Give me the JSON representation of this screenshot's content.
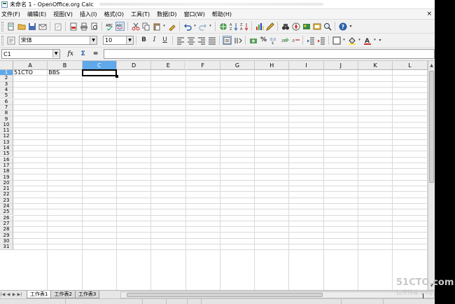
{
  "window": {
    "title": "未命名 1 - OpenOffice.org Calc"
  },
  "menubar": {
    "items": [
      "文件(F)",
      "编辑(E)",
      "视图(V)",
      "插入(I)",
      "格式(O)",
      "工具(T)",
      "数据(D)",
      "窗口(W)",
      "帮助(H)"
    ],
    "close": "×"
  },
  "formatting": {
    "style_value": "",
    "font_name": "宋体",
    "font_size": "10",
    "bold": "B",
    "italic": "I",
    "underline": "U"
  },
  "formula_bar": {
    "name_box": "C1",
    "function_wizard": "fx",
    "sum": "Σ",
    "equals": "=",
    "input_value": ""
  },
  "grid": {
    "columns": [
      "A",
      "B",
      "C",
      "D",
      "E",
      "F",
      "G",
      "H",
      "I",
      "J",
      "K",
      "L"
    ],
    "selected_column": "C",
    "rows": [
      "1",
      "2",
      "3",
      "4",
      "5",
      "6",
      "7",
      "8",
      "9",
      "10",
      "11",
      "12",
      "13",
      "14",
      "15",
      "16",
      "17",
      "18",
      "19",
      "20",
      "21",
      "22",
      "23",
      "24",
      "25",
      "26",
      "27",
      "28",
      "29",
      "30",
      "31"
    ],
    "selected_row": "1",
    "cells": {
      "A1": "51CTO",
      "B1": "BBS"
    },
    "active_cell": "C1"
  },
  "sheet_tabs": [
    "工作表1",
    "工作表2",
    "工作表3"
  ],
  "active_sheet": "工作表1",
  "watermark": {
    "line1": "51CTO.com",
    "line2": "技术博客 Blog"
  }
}
